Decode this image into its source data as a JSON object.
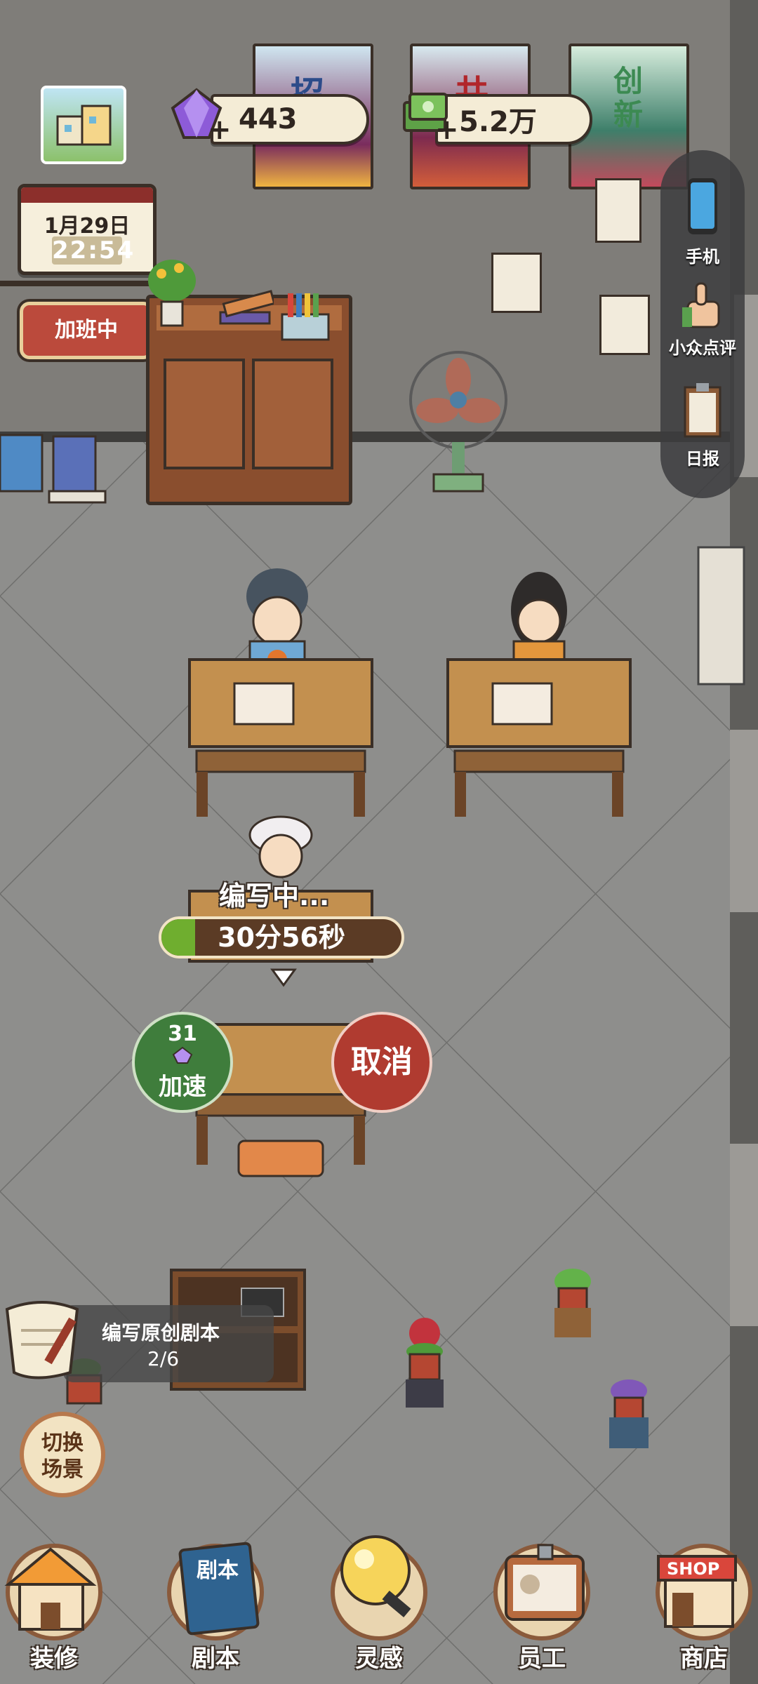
{
  "resources": {
    "gems": "443",
    "money": "5.2万",
    "plus_symbol": "+"
  },
  "clock": {
    "date": "1月29日",
    "time": "22:54"
  },
  "status_badge": "加班中",
  "posters": [
    "招",
    "共",
    "创新"
  ],
  "sidebar": {
    "items": [
      {
        "label": "手机",
        "icon": "phone-icon"
      },
      {
        "label": "小众点评",
        "icon": "thumbs-up-icon"
      },
      {
        "label": "日报",
        "icon": "clipboard-icon"
      }
    ]
  },
  "work": {
    "status": "编写中...",
    "timer": "30分56秒",
    "progress": 0.14,
    "speedup_cost": "31",
    "speedup_label": "加速",
    "cancel_label": "取消"
  },
  "task": {
    "title": "编写原创剧本",
    "progress": "2/6"
  },
  "switch_scene": "切换\n场景",
  "switch_scene_lines": [
    "切换",
    "场景"
  ],
  "nav": [
    {
      "label": "装修",
      "icon": "house-icon"
    },
    {
      "label": "剧本",
      "icon": "script-book-icon",
      "badge": "剧本"
    },
    {
      "label": "灵感",
      "icon": "lightbulb-icon"
    },
    {
      "label": "员工",
      "icon": "id-badge-icon"
    },
    {
      "label": "商店",
      "icon": "shop-icon",
      "badge": "SHOP"
    }
  ],
  "colors": {
    "floor": "#8d8d8b",
    "wall": "#7f7d79",
    "accent_green": "#6fae2f",
    "cancel_red": "#b03b30"
  }
}
